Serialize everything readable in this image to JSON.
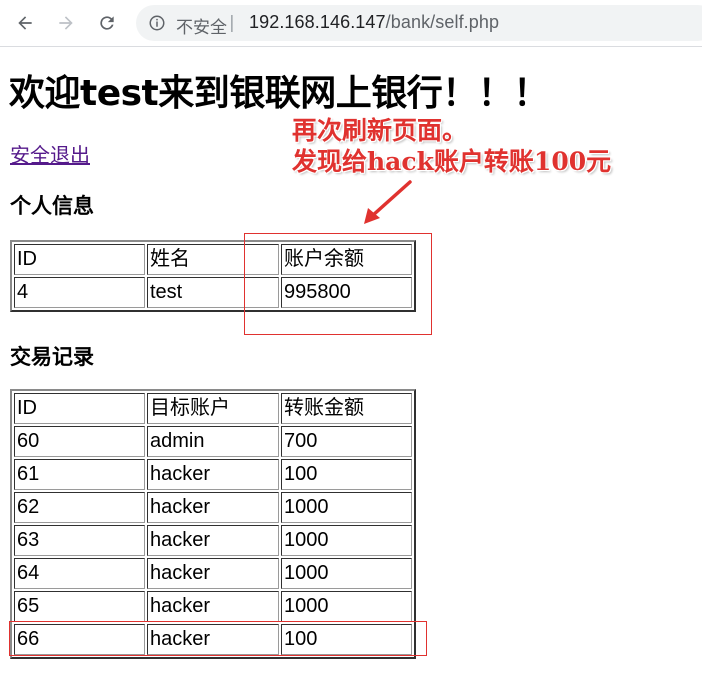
{
  "browser": {
    "security_label": "不安全",
    "separator": "|",
    "url_host": "192.168.146.147",
    "url_path": "/bank/self.php"
  },
  "page": {
    "title": "欢迎test来到银联网上银行！！！",
    "logout_label": "安全退出"
  },
  "personal_info": {
    "heading": "个人信息",
    "headers": [
      "ID",
      "姓名",
      "账户余额"
    ],
    "row": [
      "4",
      "test",
      "995800"
    ]
  },
  "transactions": {
    "heading": "交易记录",
    "headers": [
      "ID",
      "目标账户",
      "转账金额"
    ],
    "rows": [
      [
        "60",
        "admin",
        "700"
      ],
      [
        "61",
        "hacker",
        "100"
      ],
      [
        "62",
        "hacker",
        "1000"
      ],
      [
        "63",
        "hacker",
        "1000"
      ],
      [
        "64",
        "hacker",
        "1000"
      ],
      [
        "65",
        "hacker",
        "1000"
      ],
      [
        "66",
        "hacker",
        "100"
      ]
    ]
  },
  "annotation": {
    "line1": "再次刷新页面。",
    "line2": "发现给hack账户转账100元",
    "color": "#e0322f"
  }
}
